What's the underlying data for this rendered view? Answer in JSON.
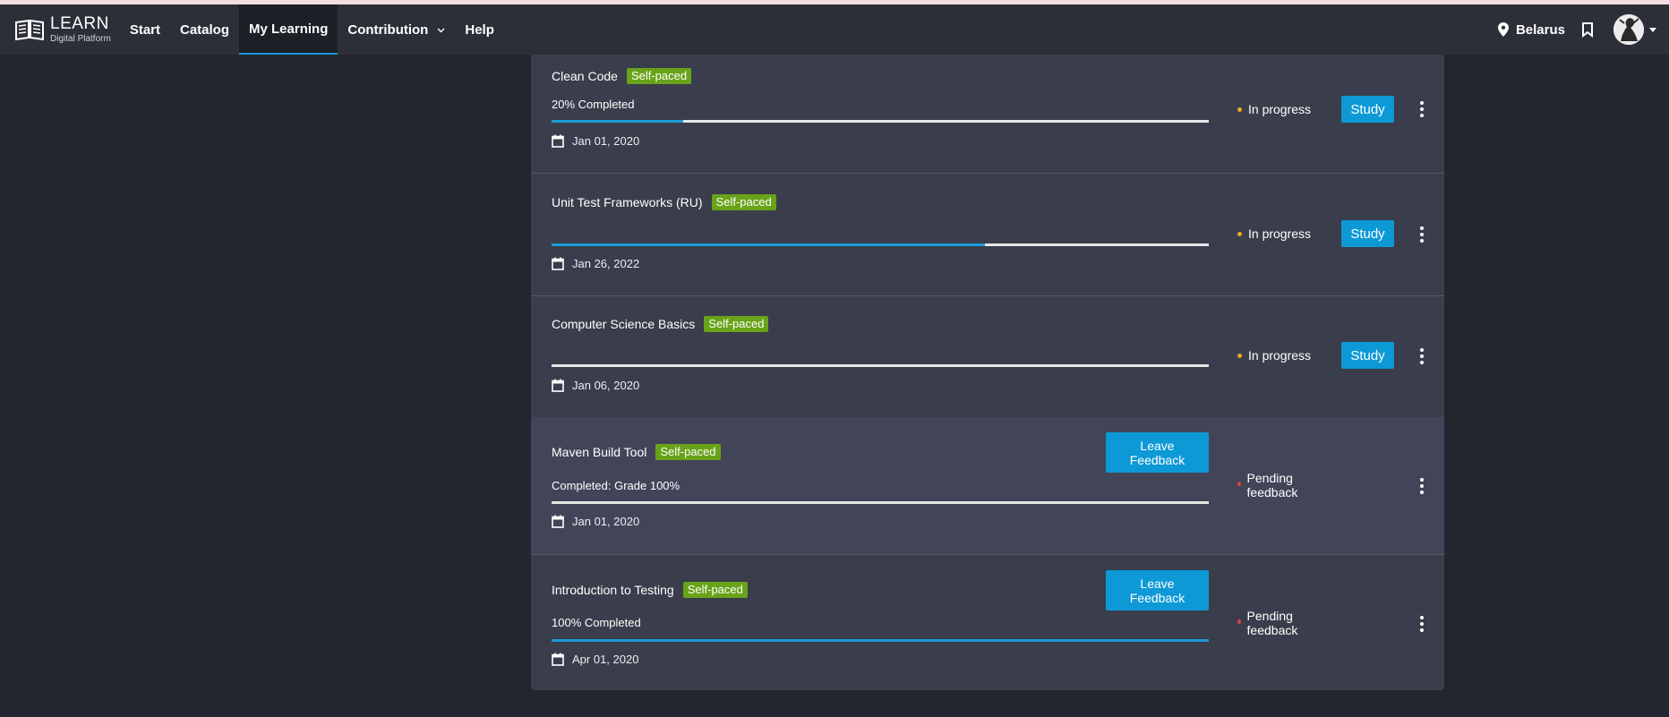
{
  "app": {
    "logo_title": "LEARN",
    "logo_subtitle": "Digital Platform"
  },
  "nav": {
    "items": [
      {
        "label": "Start"
      },
      {
        "label": "Catalog"
      },
      {
        "label": "My Learning",
        "active": true
      },
      {
        "label": "Contribution",
        "has_dropdown": true
      },
      {
        "label": "Help"
      }
    ],
    "location": "Belarus"
  },
  "colors": {
    "accent": "#1b9ad6",
    "badge": "#68a31a",
    "in_progress": "#f5a623",
    "pending": "#e0453a"
  },
  "courses": [
    {
      "title": "Clean Code",
      "badge": "Self-paced",
      "progress_label": "20% Completed",
      "progress": 0.2,
      "date": "Jan 01, 2020",
      "status": "In progress",
      "action": "Study"
    },
    {
      "title": "Unit Test Frameworks (RU)",
      "badge": "Self-paced",
      "progress_label": "",
      "progress": 0.66,
      "date": "Jan 26, 2022",
      "status": "In progress",
      "action": "Study"
    },
    {
      "title": "Computer Science Basics",
      "badge": "Self-paced",
      "progress_label": "",
      "progress": 0,
      "date": "Jan 06, 2020",
      "status": "In progress",
      "action": "Study"
    },
    {
      "title": "Maven Build Tool",
      "badge": "Self-paced",
      "progress_label": "Completed: Grade 100%",
      "progress": 0,
      "date": "Jan 01, 2020",
      "status": "Pending feedback",
      "action": "Leave Feedback"
    },
    {
      "title": "Introduction to Testing",
      "badge": "Self-paced",
      "progress_label": "100% Completed",
      "progress": 1.0,
      "date": "Apr 01, 2020",
      "status": "Pending feedback",
      "action": "Leave Feedback"
    }
  ]
}
